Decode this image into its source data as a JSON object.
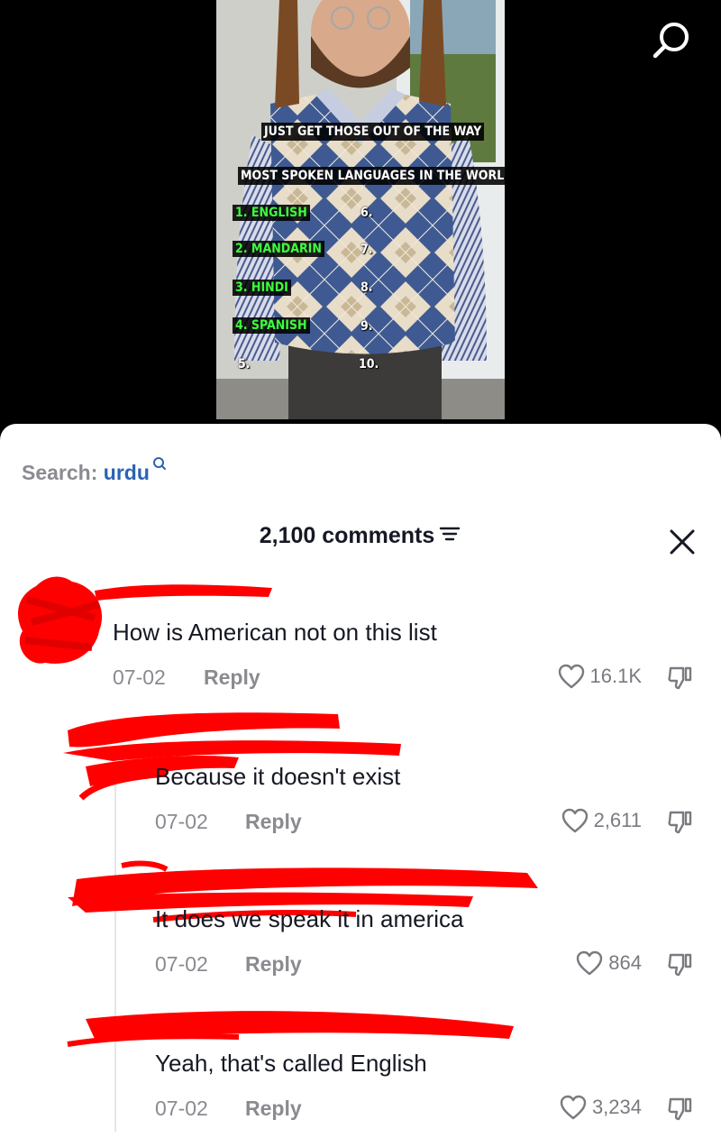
{
  "video": {
    "caption_top": "JUST GET THOSE OUT OF THE WAY",
    "caption_title": "MOST SPOKEN LANGUAGES IN THE WORLD",
    "list_left": [
      "1. ENGLISH",
      "2. MANDARIN",
      "3. HINDI",
      "4. SPANISH",
      "5."
    ],
    "list_right": [
      "6.",
      "7.",
      "8.",
      "9.",
      "10."
    ]
  },
  "search": {
    "label": "Search:",
    "term": "urdu"
  },
  "comments_header": {
    "count_label": "2,100 comments"
  },
  "comments": [
    {
      "text": "How is American not on this list",
      "date": "07-02",
      "reply": "Reply",
      "likes": "16.1K"
    },
    {
      "text": "Because it doesn't exist",
      "date": "07-02",
      "reply": "Reply",
      "likes": "2,611"
    },
    {
      "text": "It does we speak it in america",
      "date": "07-02",
      "reply": "Reply",
      "likes": "864"
    },
    {
      "text": "Yeah, that's called English",
      "date": "07-02",
      "reply": "Reply",
      "likes": "3,234"
    }
  ],
  "colors": {
    "accent_blue": "#2a63b5",
    "muted_text": "#8a8b91",
    "overlay_green": "#3dff3d",
    "redaction_red": "#ff0000"
  },
  "icons": [
    "search-icon",
    "filter-icon",
    "close-icon",
    "heart-icon",
    "dislike-icon"
  ]
}
